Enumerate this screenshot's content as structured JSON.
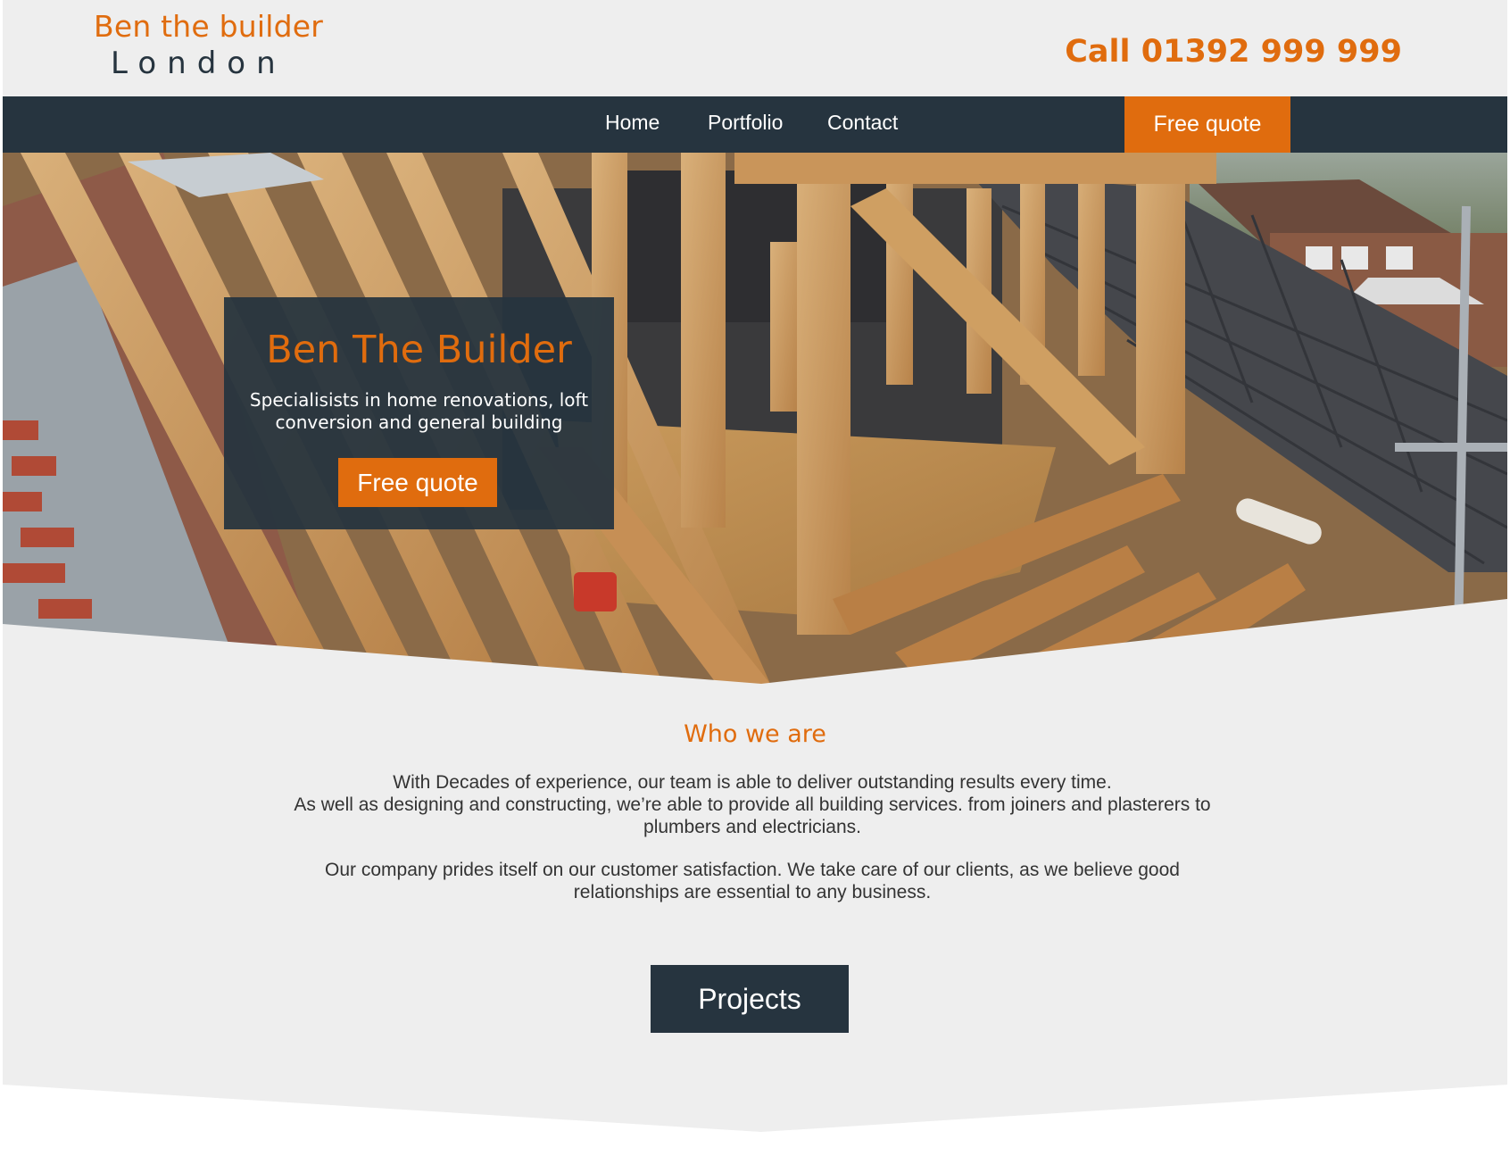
{
  "header": {
    "logo_line1": "Ben the builder",
    "logo_line2": "London",
    "phone": "Call 01392 999 999"
  },
  "nav": {
    "items": [
      "Home",
      "Portfolio",
      "Contact"
    ],
    "cta": "Free quote"
  },
  "hero": {
    "image": "loft-conversion-roof-framing-photo",
    "title": "Ben The Builder",
    "subtitle": "Specialisists in home renovations, loft conversion and general building",
    "cta": "Free quote"
  },
  "about": {
    "title": "Who we are",
    "paragraph1": "With Decades of experience, our team is able to deliver outstanding results every time.\nAs well as designing and constructing, we’re able to provide all building services. from joiners and plasterers to plumbers and electricians.",
    "paragraph2": "Our company prides itself on our customer satisfaction. We take care of our clients, as we believe good relationships are essential to any business."
  },
  "projects_button": "Projects",
  "colors": {
    "accent": "#e06c0e",
    "dark": "#26343f",
    "background": "#eeeeee"
  }
}
